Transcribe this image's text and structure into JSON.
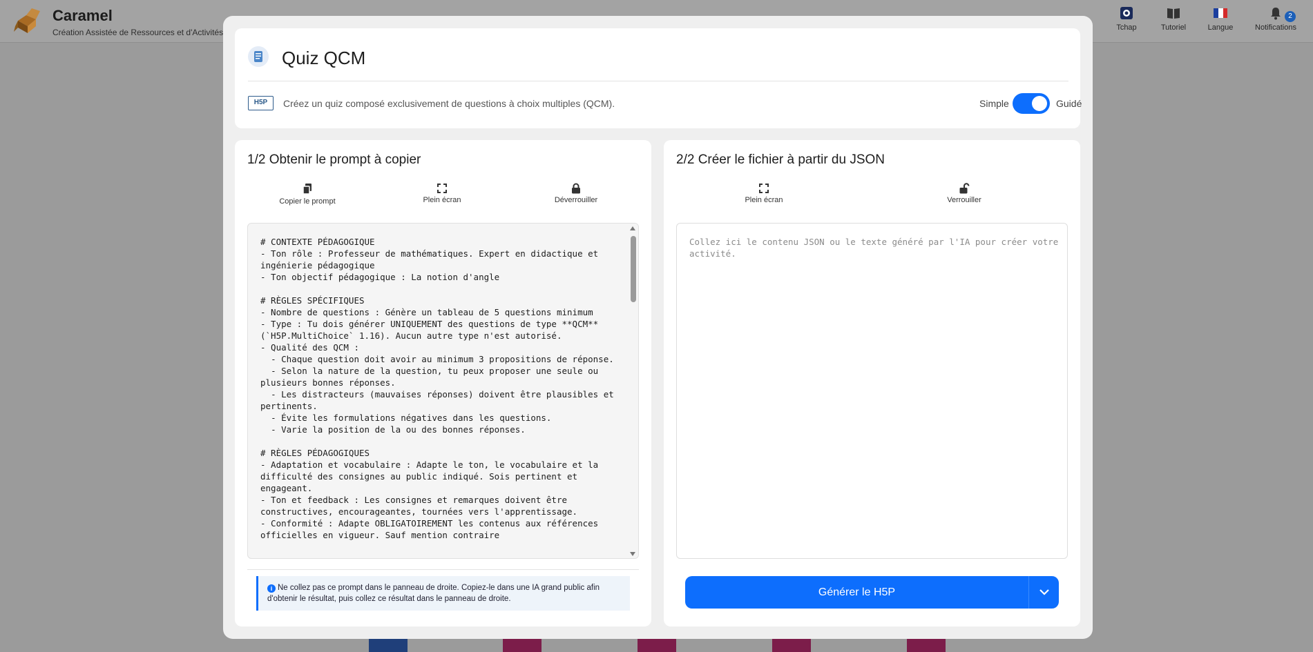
{
  "app": {
    "title": "Caramel",
    "subtitle": "Création Assistée de Ressources et d'Activités Ma"
  },
  "top_nav": [
    {
      "id": "tchap",
      "label": "Tchap",
      "icon": "tchap-icon"
    },
    {
      "id": "tutoriel",
      "label": "Tutoriel",
      "icon": "book-icon"
    },
    {
      "id": "langue",
      "label": "Langue",
      "icon": "french-flag-icon"
    },
    {
      "id": "notifications",
      "label": "Notifications",
      "icon": "bell-icon",
      "badge": "2"
    }
  ],
  "modal": {
    "title": "Quiz QCM",
    "badge": "H5P",
    "description": "Créez un quiz composé exclusivement de questions à choix multiples (QCM).",
    "mode": {
      "simple_label": "Simple",
      "guided_label": "Guidé",
      "guided_on": true
    }
  },
  "left_panel": {
    "title": "1/2 Obtenir le prompt à copier",
    "tools": {
      "copy": "Copier le prompt",
      "fullscreen": "Plein écran",
      "unlock": "Déverrouiller"
    },
    "prompt": "# CONTEXTE PÉDAGOGIQUE\n- Ton rôle : Professeur de mathématiques. Expert en didactique et ingénierie pédagogique\n- Ton objectif pédagogique : La notion d'angle\n\n# RÈGLES SPÉCIFIQUES\n- Nombre de questions : Génère un tableau de 5 questions minimum\n- Type : Tu dois générer UNIQUEMENT des questions de type **QCM** (`H5P.MultiChoice` 1.16). Aucun autre type n'est autorisé.\n- Qualité des QCM :\n  - Chaque question doit avoir au minimum 3 propositions de réponse.\n  - Selon la nature de la question, tu peux proposer une seule ou plusieurs bonnes réponses.\n  - Les distracteurs (mauvaises réponses) doivent être plausibles et pertinents.\n  - Évite les formulations négatives dans les questions.\n  - Varie la position de la ou des bonnes réponses.\n\n# RÈGLES PÉDAGOGIQUES\n- Adaptation et vocabulaire : Adapte le ton, le vocabulaire et la difficulté des consignes au public indiqué. Sois pertinent et engageant.\n- Ton et feedback : Les consignes et remarques doivent être constructives, encourageantes, tournées vers l'apprentissage.\n- Conformité : Adapte OBLIGATOIREMENT les contenus aux références officielles en vigueur. Sauf mention contraire",
    "info": "Ne collez pas ce prompt dans le panneau de droite. Copiez-le dans une IA grand public afin d'obtenir le résultat, puis collez ce résultat dans le panneau de droite."
  },
  "right_panel": {
    "title": "2/2 Créer le fichier à partir du JSON",
    "tools": {
      "fullscreen": "Plein écran",
      "lock": "Verrouiller"
    },
    "placeholder": "Collez ici le contenu JSON ou le texte généré par l'IA pour créer votre activité.",
    "generate_label": "Générer le H5P"
  },
  "colors": {
    "accent": "#0d6efd",
    "overlay": "#9b9b9b",
    "panel": "#ffffff"
  }
}
